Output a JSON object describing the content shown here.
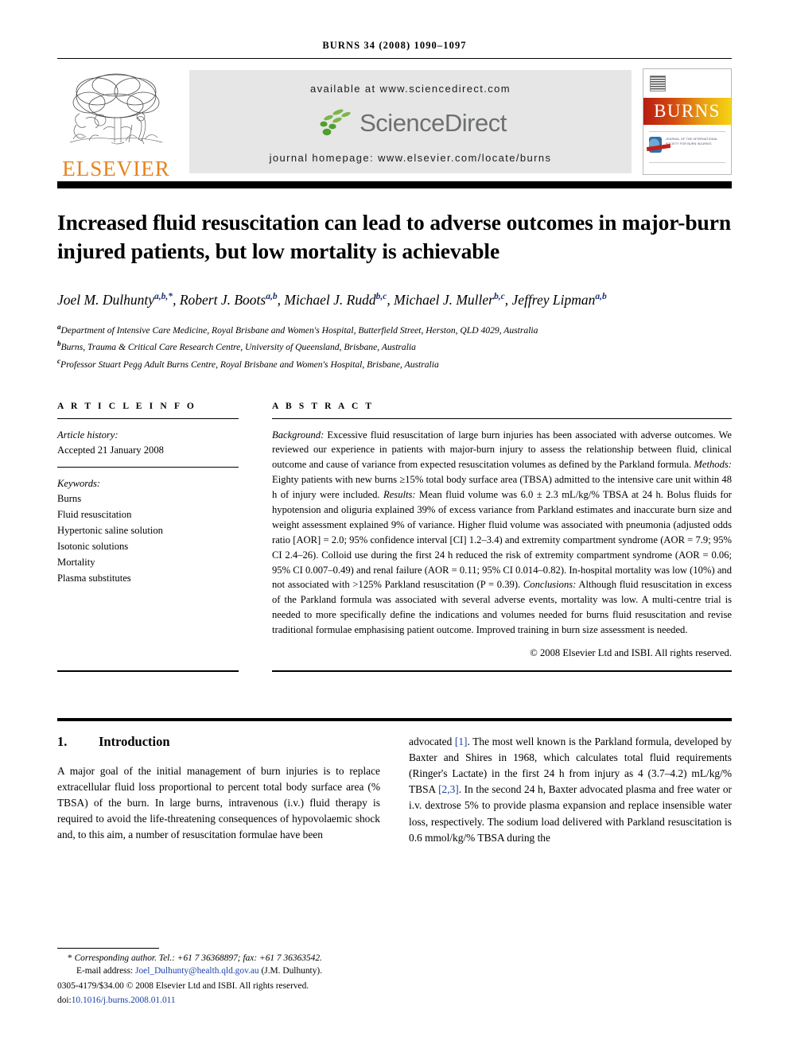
{
  "running_head": "BURNS 34 (2008) 1090–1097",
  "masthead": {
    "publisher": "ELSEVIER",
    "publisher_icon": "elsevier-tree-logo",
    "available_at": "available at www.sciencedirect.com",
    "sciencedirect_wordmark": "ScienceDirect",
    "sciencedirect_icon": "sciencedirect-leaf-logo",
    "journal_homepage": "journal homepage: www.elsevier.com/locate/burns",
    "cover": {
      "journal_name": "BURNS",
      "society_badge_icon": "isbi-society-icon",
      "society_line": "JOURNAL OF THE INTERNATIONAL SOCIETY FOR BURN INJURIES",
      "band_color_start": "#b81d11",
      "band_color_end": "#f5d312"
    },
    "brand_color": "#E8821E"
  },
  "article": {
    "title": "Increased fluid resuscitation can lead to adverse outcomes in major-burn injured patients, but low mortality is achievable",
    "authors": [
      {
        "name": "Joel M. Dulhunty",
        "marks": "a,b,*"
      },
      {
        "name": "Robert J. Boots",
        "marks": "a,b"
      },
      {
        "name": "Michael J. Rudd",
        "marks": "b,c"
      },
      {
        "name": "Michael J. Muller",
        "marks": "b,c"
      },
      {
        "name": "Jeffrey Lipman",
        "marks": "a,b"
      }
    ],
    "affiliations": [
      {
        "mark": "a",
        "text": "Department of Intensive Care Medicine, Royal Brisbane and Women's Hospital, Butterfield Street, Herston, QLD 4029, Australia"
      },
      {
        "mark": "b",
        "text": "Burns, Trauma & Critical Care Research Centre, University of Queensland, Brisbane, Australia"
      },
      {
        "mark": "c",
        "text": "Professor Stuart Pegg Adult Burns Centre, Royal Brisbane and Women's Hospital, Brisbane, Australia"
      }
    ]
  },
  "article_info": {
    "heading": "A R T I C L E   I N F O",
    "history_label": "Article history:",
    "history_value": "Accepted 21 January 2008",
    "keywords_label": "Keywords:",
    "keywords": [
      "Burns",
      "Fluid resuscitation",
      "Hypertonic saline solution",
      "Isotonic solutions",
      "Mortality",
      "Plasma substitutes"
    ]
  },
  "abstract": {
    "heading": "A B S T R A C T",
    "sections": [
      {
        "label": "Background:",
        "text": " Excessive fluid resuscitation of large burn injuries has been associated with adverse outcomes. We reviewed our experience in patients with major-burn injury to assess the relationship between fluid, clinical outcome and cause of variance from expected resuscitation volumes as defined by the Parkland formula."
      },
      {
        "label": "Methods:",
        "text": " Eighty patients with new burns ≥15% total body surface area (TBSA) admitted to the intensive care unit within 48 h of injury were included."
      },
      {
        "label": "Results:",
        "text": " Mean fluid volume was 6.0 ± 2.3 mL/kg/% TBSA at 24 h. Bolus fluids for hypotension and oliguria explained 39% of excess variance from Parkland estimates and inaccurate burn size and weight assessment explained 9% of variance. Higher fluid volume was associated with pneumonia (adjusted odds ratio [AOR] = 2.0; 95% confidence interval [CI] 1.2–3.4) and extremity compartment syndrome (AOR = 7.9; 95% CI 2.4–26). Colloid use during the first 24 h reduced the risk of extremity compartment syndrome (AOR = 0.06; 95% CI 0.007–0.49) and renal failure (AOR = 0.11; 95% CI 0.014–0.82). In-hospital mortality was low (10%) and not associated with >125% Parkland resuscitation (P = 0.39)."
      },
      {
        "label": "Conclusions:",
        "text": " Although fluid resuscitation in excess of the Parkland formula was associated with several adverse events, mortality was low. A multi-centre trial is needed to more specifically define the indications and volumes needed for burns fluid resuscitation and revise traditional formulae emphasising patient outcome. Improved training in burn size assessment is needed."
      }
    ],
    "copyright": "© 2008 Elsevier Ltd and ISBI. All rights reserved."
  },
  "body": {
    "section_number": "1.",
    "section_title": "Introduction",
    "left_column": "A major goal of the initial management of burn injuries is to replace extracellular fluid loss proportional to percent total body surface area (% TBSA) of the burn. In large burns, intravenous (i.v.) fluid therapy is required to avoid the life-threatening consequences of hypovolaemic shock and, to this aim, a number of resuscitation formulae have been",
    "right_column_parts": [
      {
        "t": "advocated "
      },
      {
        "t": "[1]",
        "ref": true
      },
      {
        "t": ". The most well known is the Parkland formula, developed by Baxter and Shires in 1968, which calculates total fluid requirements (Ringer's Lactate) in the first 24 h from injury as 4 (3.7–4.2) mL/kg/% TBSA "
      },
      {
        "t": "[2,3]",
        "ref": true
      },
      {
        "t": ". In the second 24 h, Baxter advocated plasma and free water or i.v. dextrose 5% to provide plasma expansion and replace insensible water loss, respectively. The sodium load delivered with Parkland resuscitation is 0.6 mmol/kg/% TBSA during the"
      }
    ]
  },
  "footnote": {
    "corresponding_marker": "*",
    "corresponding_text": "Corresponding author. Tel.: +61 7 36368897; fax: +61 7 36363542.",
    "email_label": "E-mail address:",
    "email": "Joel_Dulhunty@health.qld.gov.au",
    "email_owner": "(J.M. Dulhunty).",
    "issn_line": "0305-4179/$34.00 © 2008 Elsevier Ltd and ISBI. All rights reserved.",
    "doi_label": "doi:",
    "doi": "10.1016/j.burns.2008.01.011",
    "link_color": "#1A3FA8"
  }
}
